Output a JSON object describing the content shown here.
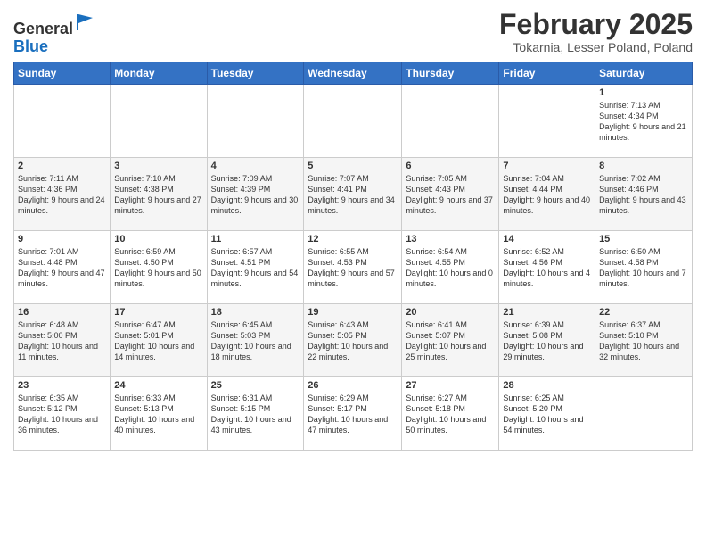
{
  "header": {
    "logo_general": "General",
    "logo_blue": "Blue",
    "month_title": "February 2025",
    "subtitle": "Tokarnia, Lesser Poland, Poland"
  },
  "days_of_week": [
    "Sunday",
    "Monday",
    "Tuesday",
    "Wednesday",
    "Thursday",
    "Friday",
    "Saturday"
  ],
  "weeks": [
    [
      {
        "day": "",
        "info": ""
      },
      {
        "day": "",
        "info": ""
      },
      {
        "day": "",
        "info": ""
      },
      {
        "day": "",
        "info": ""
      },
      {
        "day": "",
        "info": ""
      },
      {
        "day": "",
        "info": ""
      },
      {
        "day": "1",
        "info": "Sunrise: 7:13 AM\nSunset: 4:34 PM\nDaylight: 9 hours and 21 minutes."
      }
    ],
    [
      {
        "day": "2",
        "info": "Sunrise: 7:11 AM\nSunset: 4:36 PM\nDaylight: 9 hours and 24 minutes."
      },
      {
        "day": "3",
        "info": "Sunrise: 7:10 AM\nSunset: 4:38 PM\nDaylight: 9 hours and 27 minutes."
      },
      {
        "day": "4",
        "info": "Sunrise: 7:09 AM\nSunset: 4:39 PM\nDaylight: 9 hours and 30 minutes."
      },
      {
        "day": "5",
        "info": "Sunrise: 7:07 AM\nSunset: 4:41 PM\nDaylight: 9 hours and 34 minutes."
      },
      {
        "day": "6",
        "info": "Sunrise: 7:05 AM\nSunset: 4:43 PM\nDaylight: 9 hours and 37 minutes."
      },
      {
        "day": "7",
        "info": "Sunrise: 7:04 AM\nSunset: 4:44 PM\nDaylight: 9 hours and 40 minutes."
      },
      {
        "day": "8",
        "info": "Sunrise: 7:02 AM\nSunset: 4:46 PM\nDaylight: 9 hours and 43 minutes."
      }
    ],
    [
      {
        "day": "9",
        "info": "Sunrise: 7:01 AM\nSunset: 4:48 PM\nDaylight: 9 hours and 47 minutes."
      },
      {
        "day": "10",
        "info": "Sunrise: 6:59 AM\nSunset: 4:50 PM\nDaylight: 9 hours and 50 minutes."
      },
      {
        "day": "11",
        "info": "Sunrise: 6:57 AM\nSunset: 4:51 PM\nDaylight: 9 hours and 54 minutes."
      },
      {
        "day": "12",
        "info": "Sunrise: 6:55 AM\nSunset: 4:53 PM\nDaylight: 9 hours and 57 minutes."
      },
      {
        "day": "13",
        "info": "Sunrise: 6:54 AM\nSunset: 4:55 PM\nDaylight: 10 hours and 0 minutes."
      },
      {
        "day": "14",
        "info": "Sunrise: 6:52 AM\nSunset: 4:56 PM\nDaylight: 10 hours and 4 minutes."
      },
      {
        "day": "15",
        "info": "Sunrise: 6:50 AM\nSunset: 4:58 PM\nDaylight: 10 hours and 7 minutes."
      }
    ],
    [
      {
        "day": "16",
        "info": "Sunrise: 6:48 AM\nSunset: 5:00 PM\nDaylight: 10 hours and 11 minutes."
      },
      {
        "day": "17",
        "info": "Sunrise: 6:47 AM\nSunset: 5:01 PM\nDaylight: 10 hours and 14 minutes."
      },
      {
        "day": "18",
        "info": "Sunrise: 6:45 AM\nSunset: 5:03 PM\nDaylight: 10 hours and 18 minutes."
      },
      {
        "day": "19",
        "info": "Sunrise: 6:43 AM\nSunset: 5:05 PM\nDaylight: 10 hours and 22 minutes."
      },
      {
        "day": "20",
        "info": "Sunrise: 6:41 AM\nSunset: 5:07 PM\nDaylight: 10 hours and 25 minutes."
      },
      {
        "day": "21",
        "info": "Sunrise: 6:39 AM\nSunset: 5:08 PM\nDaylight: 10 hours and 29 minutes."
      },
      {
        "day": "22",
        "info": "Sunrise: 6:37 AM\nSunset: 5:10 PM\nDaylight: 10 hours and 32 minutes."
      }
    ],
    [
      {
        "day": "23",
        "info": "Sunrise: 6:35 AM\nSunset: 5:12 PM\nDaylight: 10 hours and 36 minutes."
      },
      {
        "day": "24",
        "info": "Sunrise: 6:33 AM\nSunset: 5:13 PM\nDaylight: 10 hours and 40 minutes."
      },
      {
        "day": "25",
        "info": "Sunrise: 6:31 AM\nSunset: 5:15 PM\nDaylight: 10 hours and 43 minutes."
      },
      {
        "day": "26",
        "info": "Sunrise: 6:29 AM\nSunset: 5:17 PM\nDaylight: 10 hours and 47 minutes."
      },
      {
        "day": "27",
        "info": "Sunrise: 6:27 AM\nSunset: 5:18 PM\nDaylight: 10 hours and 50 minutes."
      },
      {
        "day": "28",
        "info": "Sunrise: 6:25 AM\nSunset: 5:20 PM\nDaylight: 10 hours and 54 minutes."
      },
      {
        "day": "",
        "info": ""
      }
    ]
  ]
}
